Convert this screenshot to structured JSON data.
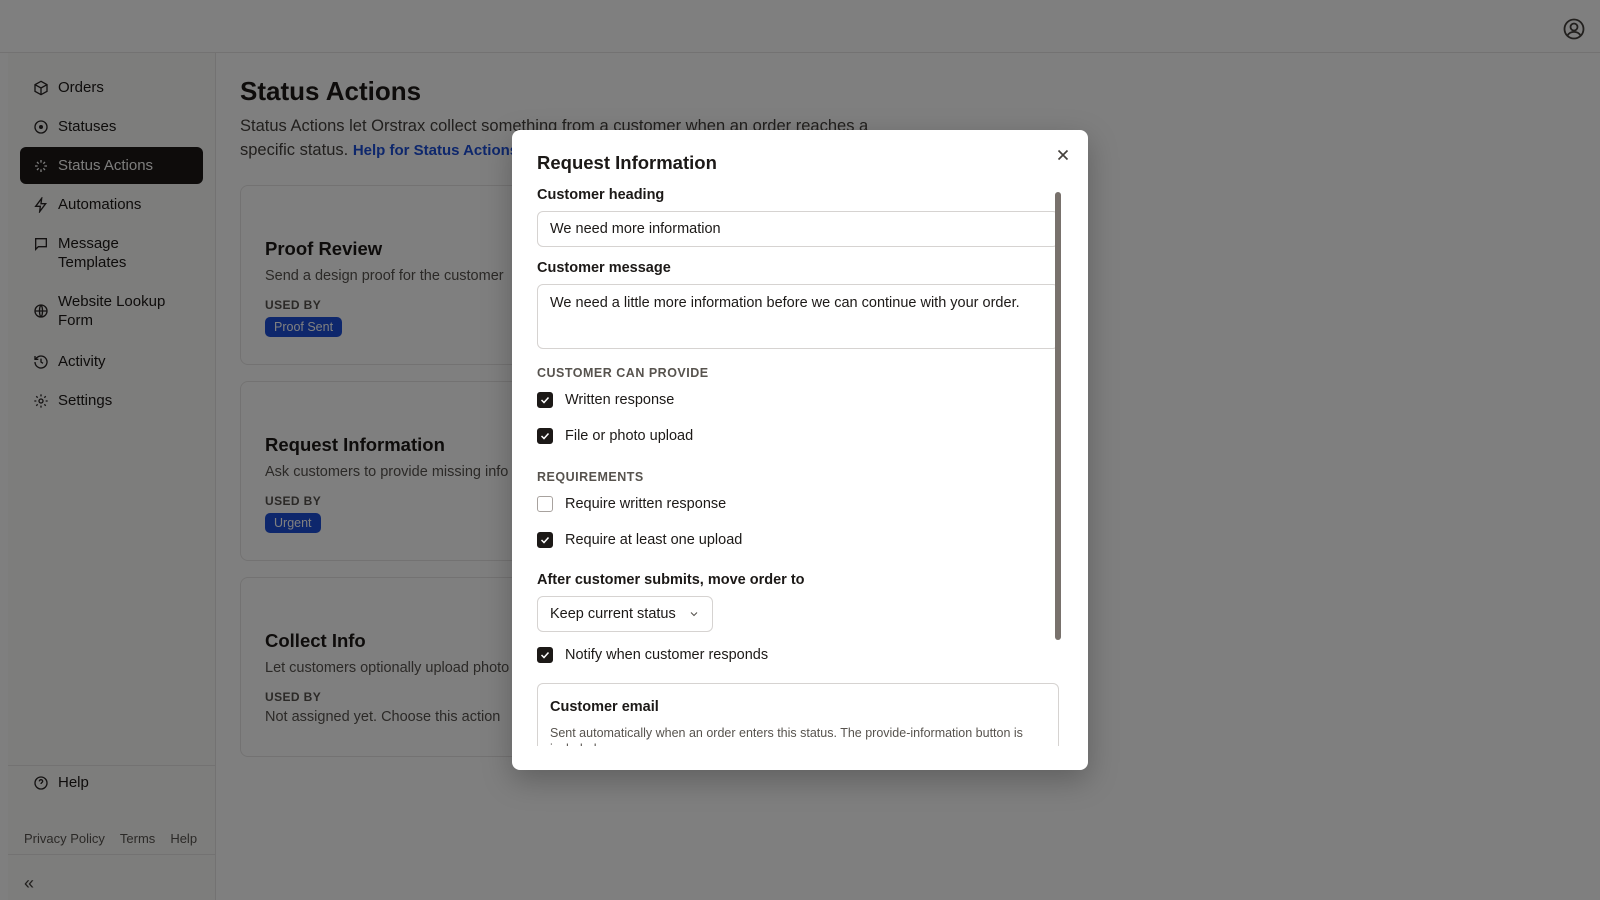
{
  "sidebar": {
    "items": [
      {
        "label": "Orders",
        "icon": "package-icon"
      },
      {
        "label": "Statuses",
        "icon": "circle-dot-icon"
      },
      {
        "label": "Status Actions",
        "icon": "sparkle-icon",
        "active": true
      },
      {
        "label": "Automations",
        "icon": "lightning-icon"
      },
      {
        "label": "Message Templates",
        "icon": "message-icon"
      },
      {
        "label": "Website Lookup Form",
        "icon": "globe-icon"
      },
      {
        "label": "Activity",
        "icon": "history-icon"
      },
      {
        "label": "Settings",
        "icon": "gear-icon"
      }
    ],
    "help_label": "Help",
    "footer_links": [
      "Privacy Policy",
      "Terms",
      "Help"
    ],
    "collapse_label": "«"
  },
  "page": {
    "title": "Status Actions",
    "description": "Status Actions let Orstrax collect something from a customer when an order reaches a specific status.",
    "help_link": "Help for Status Actions",
    "cards": [
      {
        "title": "Proof Review",
        "description": "Send a design proof for the customer",
        "used_by_label": "USED BY",
        "badge": "Proof Sent"
      },
      {
        "title": "Request Information",
        "description": "Ask customers to provide missing info",
        "used_by_label": "USED BY",
        "badge": "Urgent"
      },
      {
        "title": "Collect Info",
        "description": "Let customers optionally upload photo",
        "used_by_label": "USED BY",
        "none_text": "Not assigned yet. Choose this action"
      }
    ]
  },
  "modal": {
    "title": "Request Information",
    "heading_label": "Customer heading",
    "heading_value": "We need more information",
    "message_label": "Customer message",
    "message_value": "We need a little more information before we can continue with your order.",
    "provide_section": "CUSTOMER CAN PROVIDE",
    "written_response": "Written response",
    "written_response_checked": true,
    "file_upload": "File or photo upload",
    "file_upload_checked": true,
    "requirements_section": "REQUIREMENTS",
    "require_written": "Require written response",
    "require_written_checked": false,
    "require_upload": "Require at least one upload",
    "require_upload_checked": true,
    "move_label": "After customer submits, move order to",
    "move_value": "Keep current status",
    "notify_label": "Notify when customer responds",
    "notify_checked": true,
    "email_title": "Customer email",
    "email_desc": "Sent automatically when an order enters this status. The provide-information button is included."
  },
  "colors": {
    "active_nav": "#1c1917",
    "badge": "#1d4ed8",
    "link": "#1d4ed8",
    "overlay": "rgba(0,0,0,0.5)"
  }
}
